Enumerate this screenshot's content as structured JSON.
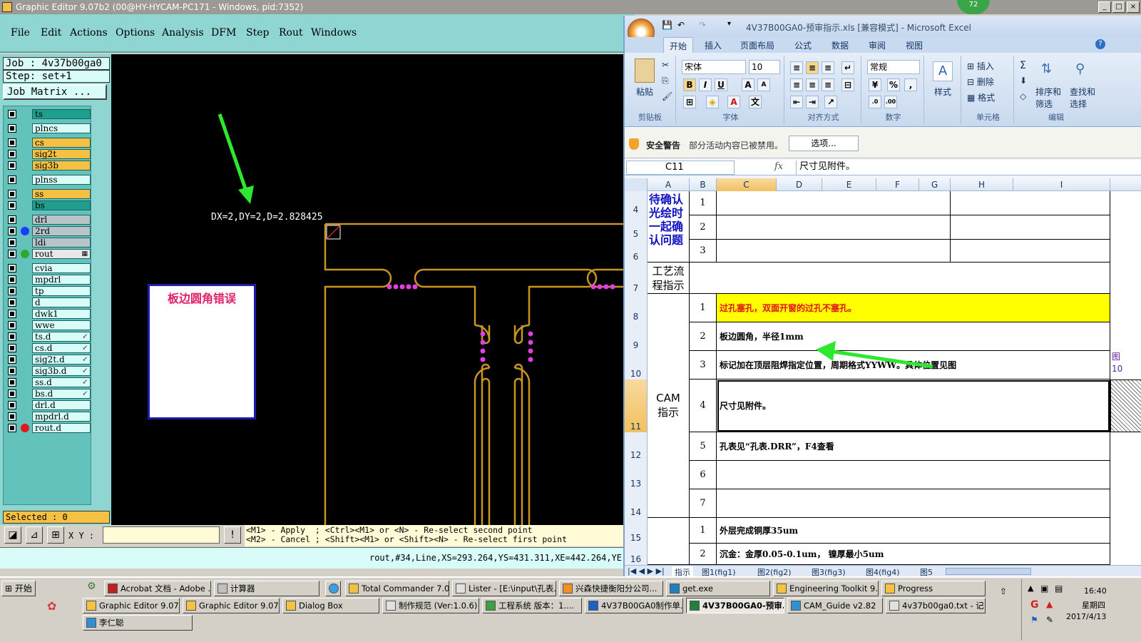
{
  "ge": {
    "title": "Graphic Editor 9.07b2 (00@HY-HYCAM-PC171 - Windows, pid:7352)",
    "badge": "72",
    "window_buttons": [
      "_",
      "□",
      "×"
    ],
    "menu": [
      "File",
      "Edit",
      "Actions",
      "Options",
      "Analysis",
      "DFM",
      "Step",
      "Rout",
      "Windows"
    ],
    "job": "Job : 4v37b00ga0",
    "step": "Step: set+1",
    "job_matrix": "Job Matrix ...",
    "layers": [
      {
        "name": "ts",
        "color": "#1f9e8e"
      },
      {
        "name": "plncs",
        "color": "#d8fcf8"
      },
      {
        "name": "cs",
        "color": "#f6c042"
      },
      {
        "name": "sig2t",
        "color": "#f6c042"
      },
      {
        "name": "sig3b",
        "color": "#f6c042"
      },
      {
        "name": "plnss",
        "color": "#d8fcf8"
      },
      {
        "name": "ss",
        "color": "#f6c042"
      },
      {
        "name": "bs",
        "color": "#1f9e8e"
      },
      {
        "name": "drl",
        "color": "#b8c4c8"
      },
      {
        "name": "2rd",
        "color": "#b8c4c8",
        "dot": "#1a3cff"
      },
      {
        "name": "ldi",
        "color": "#b8c4c8"
      },
      {
        "name": "rout",
        "color": "#e8e8e8",
        "dot": "#2fa830",
        "mark": "▦"
      },
      {
        "name": "cvia",
        "color": "#d8fcf8"
      },
      {
        "name": "mpdrl",
        "color": "#d8fcf8"
      },
      {
        "name": "tp",
        "color": "#d8fcf8"
      },
      {
        "name": "d",
        "color": "#d8fcf8"
      },
      {
        "name": "dwk1",
        "color": "#d8fcf8"
      },
      {
        "name": "wwe",
        "color": "#d8fcf8"
      },
      {
        "name": "ts.d",
        "color": "#d8fcf8",
        "mark": "↙"
      },
      {
        "name": "cs.d",
        "color": "#d8fcf8",
        "mark": "↙"
      },
      {
        "name": "sig2t.d",
        "color": "#d8fcf8",
        "mark": "↙"
      },
      {
        "name": "sig3b.d",
        "color": "#d8fcf8",
        "mark": "↙"
      },
      {
        "name": "ss.d",
        "color": "#d8fcf8",
        "mark": "↙"
      },
      {
        "name": "bs.d",
        "color": "#d8fcf8",
        "mark": "↙"
      },
      {
        "name": "drl.d",
        "color": "#d8fcf8"
      },
      {
        "name": "mpdrl.d",
        "color": "#d8fcf8"
      },
      {
        "name": "rout.d",
        "color": "#d8fcf8",
        "dot": "#e01818"
      }
    ],
    "selected": "Selected : 0",
    "measure": "DX=2,DY=2,D=2.828425",
    "note": "板边圆角错误",
    "xy_label": "X Y :",
    "help_line1": "<M1> - Apply  ; <Ctrl><M1> or <N> - Re-select second point",
    "help_line2": "<M2> - Cancel ; <Shift><M1> or <Shift><N> - Re-select first point",
    "status": "rout,#34,Line,XS=293.264,YS=431.311,XE=442.264,YE"
  },
  "excel": {
    "quick_access": [
      "💾",
      "↶",
      "↷",
      "▾"
    ],
    "title": "4V37B00GA0-预审指示.xls  [兼容模式] - Microsoft Excel",
    "tabs": [
      "开始",
      "插入",
      "页面布局",
      "公式",
      "数据",
      "审阅",
      "视图"
    ],
    "ribbon": {
      "clipboard": {
        "paste": "粘贴",
        "label": "剪贴板"
      },
      "font": {
        "name": "宋体",
        "size": "10",
        "bold": "B",
        "italic": "I",
        "underline": "U",
        "label": "字体"
      },
      "align": {
        "label": "对齐方式"
      },
      "number": {
        "format": "常规",
        "percent": "%",
        "label": "数字"
      },
      "styles": {
        "btn": "样式"
      },
      "cells": {
        "insert": "插入",
        "delete": "删除",
        "format": "格式",
        "label": "单元格"
      },
      "edit": {
        "sort": "排序和",
        "filter": "筛选",
        "find": "查找和",
        "select": "选择",
        "label": "编辑"
      }
    },
    "security_title": "安全警告",
    "security_msg": "部分活动内容已被禁用。",
    "security_btn": "选项...",
    "namebox": "C11",
    "fx": "fx",
    "formula": "尺寸见附件。",
    "columns": [
      "A",
      "B",
      "C",
      "D",
      "E",
      "F",
      "G",
      "H",
      "I"
    ],
    "rows": [
      "4",
      "5",
      "6",
      "7",
      "8",
      "9",
      "10",
      "11",
      "12",
      "13",
      "14",
      "15",
      "16"
    ],
    "pending_label": "待确认光绘时一起确认问题",
    "process_label": "工艺流程指示",
    "cam_label": "CAM指示",
    "pending_nums": [
      "1",
      "2",
      "3"
    ],
    "cam_items": [
      {
        "n": "1",
        "text": "过孔塞孔，双面开窗的过孔不塞孔。"
      },
      {
        "n": "2",
        "text": "板边圆角，半径1mm"
      },
      {
        "n": "3",
        "text": "标记加在顶层阻焊指定位置，周期格式YYWW。具体位置见图"
      },
      {
        "n": "4",
        "text": "尺寸见附件。"
      },
      {
        "n": "5",
        "text": "孔表见“孔表.DRR”，F4查看"
      },
      {
        "n": "6",
        "text": ""
      },
      {
        "n": "7",
        "text": ""
      }
    ],
    "next_items": [
      {
        "n": "1",
        "text": "外层完成铜厚35um"
      },
      {
        "n": "2",
        "text": "沉金：金厚0.05-0.1um， 镍厚最小5um"
      }
    ],
    "sheets": [
      "指示",
      "图1(fig1)",
      "图2(fig2)",
      "图3(fig3)",
      "图4(fig4)",
      "图5"
    ],
    "overflow_ref": "图",
    "overflow_num": "10"
  },
  "taskbar": {
    "start": "开始",
    "row1": [
      {
        "label": "Acrobat 文档 - Adobe ..."
      },
      {
        "label": "计算器"
      },
      {
        "label": "Total Commander 7.0 p..."
      },
      {
        "label": "Lister - [E:\\input\\孔表...."
      },
      {
        "label": "兴森快捷衡阳分公司..."
      },
      {
        "label": "get.exe"
      },
      {
        "label": "Engineering Toolkit 9.0..."
      },
      {
        "label": "Progress"
      }
    ],
    "row2": [
      {
        "label": "Graphic Editor 9.07b..."
      },
      {
        "label": "Graphic Editor 9.07b..."
      },
      {
        "label": "Dialog Box"
      },
      {
        "label": "制作规范 (Ver:1.0.6)"
      },
      {
        "label": "工程系统  版本：1...."
      },
      {
        "label": "4V37B00GA0制作单...."
      },
      {
        "label": "4V37B00GA0-预审...",
        "active": true
      },
      {
        "label": "CAM_Guide v2.82"
      },
      {
        "label": "4v37b00ga0.txt - 记..."
      }
    ],
    "row3": [
      {
        "label": "李仁聪"
      }
    ],
    "time": "16:40",
    "weekday": "星期四",
    "date": "2017/4/13"
  }
}
